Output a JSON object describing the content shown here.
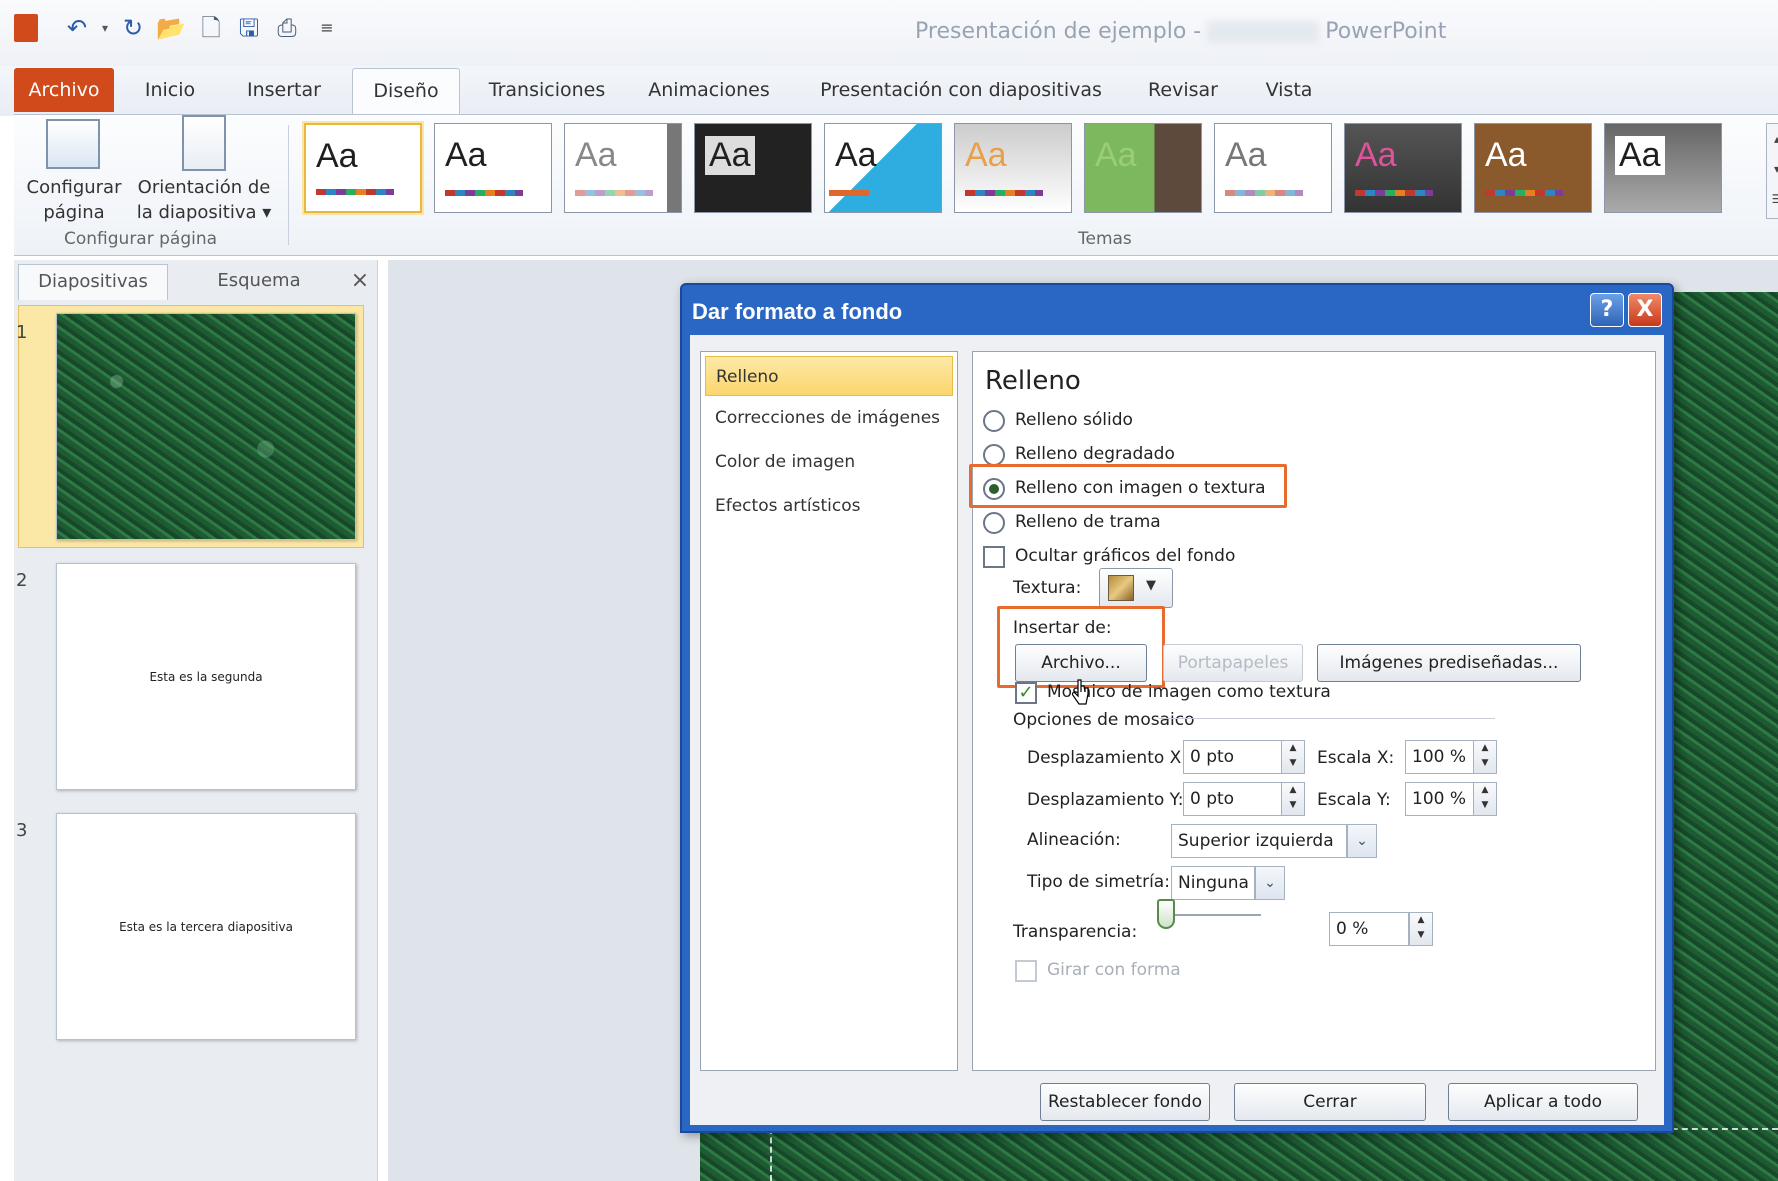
{
  "window": {
    "title_prefix": "Presentación de ejemplo -",
    "title_app": "PowerPoint"
  },
  "qat": {
    "icons": [
      "powerpoint-logo-icon",
      "undo-icon",
      "redo-icon",
      "open-folder-icon",
      "new-document-icon",
      "save-icon",
      "print-icon",
      "customize-qat-icon"
    ]
  },
  "tabs": {
    "file": "Archivo",
    "home": "Inicio",
    "insert": "Insertar",
    "design": "Diseño",
    "transitions": "Transiciones",
    "animations": "Animaciones",
    "slideshow": "Presentación con diapositivas",
    "review": "Revisar",
    "view": "Vista"
  },
  "ribbon": {
    "page_setup": {
      "label_line1": "Configurar",
      "label_line2": "página"
    },
    "orientation": {
      "label_line1": "Orientación de",
      "label_line2": "la diapositiva ▾"
    },
    "group_page": "Configurar página",
    "group_themes": "Temas",
    "theme_glyph": "Aa"
  },
  "leftpane": {
    "tab_slides": "Diapositivas",
    "tab_outline": "Esquema",
    "close": "×",
    "slides": [
      {
        "num": "1",
        "text": ""
      },
      {
        "num": "2",
        "text": "Esta es la segunda"
      },
      {
        "num": "3",
        "text": "Esta es la tercera diapositiva"
      }
    ]
  },
  "dialog": {
    "title": "Dar formato a fondo",
    "help": "?",
    "close": "X",
    "nav": [
      "Relleno",
      "Correcciones de imágenes",
      "Color de imagen",
      "Efectos artísticos"
    ],
    "section_title": "Relleno",
    "fill_options": [
      "Relleno sólido",
      "Relleno degradado",
      "Relleno con imagen o textura",
      "Relleno de trama"
    ],
    "selected_fill": "Relleno con imagen o textura",
    "hide_graphics": "Ocultar gráficos del fondo",
    "texture_label": "Textura:",
    "insert_from": "Insertar de:",
    "btn_file": "Archivo...",
    "btn_clipboard": "Portapapeles",
    "btn_clipart": "Imágenes prediseñadas...",
    "tile_checkbox": "Mosaico de imagen como textura",
    "tile_options": "Opciones de mosaico",
    "offset_x_label": "Desplazamiento X:",
    "offset_x_value": "0 pto",
    "scale_x_label": "Escala X:",
    "scale_x_value": "100 %",
    "offset_y_label": "Desplazamiento Y:",
    "offset_y_value": "0 pto",
    "scale_y_label": "Escala Y:",
    "scale_y_value": "100 %",
    "align_label": "Alineación:",
    "align_value": "Superior izquierda",
    "mirror_label": "Tipo de simetría:",
    "mirror_value": "Ninguna",
    "transparency_label": "Transparencia:",
    "transparency_value": "0 %",
    "rotate_label": "Girar con forma",
    "btn_reset": "Restablecer fondo",
    "btn_close": "Cerrar",
    "btn_apply_all": "Aplicar a todo"
  },
  "colors": {
    "file_tab": "#d04a1b",
    "dialog_title": "#2a66c4",
    "highlight": "#e86a2f",
    "slide_green": "#23623a"
  }
}
